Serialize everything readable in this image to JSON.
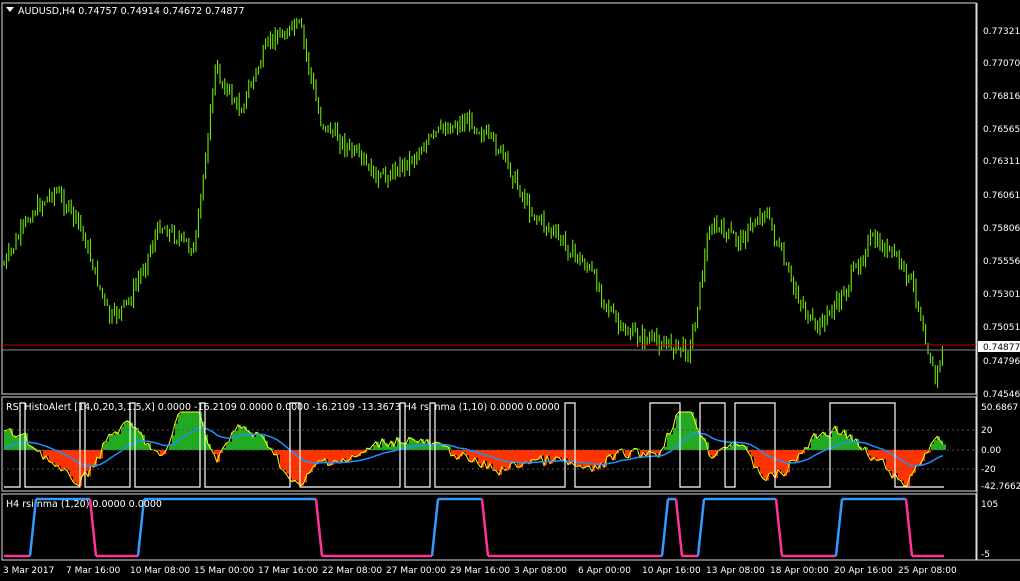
{
  "symbol_header": "AUDUSD,H4  0.74757 0.74914 0.74672 0.74877",
  "price_axis": [
    "0.77321",
    "0.77070",
    "0.76816",
    "0.76565",
    "0.76311",
    "0.76061",
    "0.75806",
    "0.75556",
    "0.75301",
    "0.75051",
    "0.74796",
    "0.74546"
  ],
  "current_price": "0.74877",
  "rsi_header": "RSI HistoAlert [14,0,20,3,1.5,X] 0.0000 -16.2109 0.0000 0.0000 -16.2109 -13.3673  H4 rsi nma (1,10) 0.0000 0.0000",
  "rsi_axis": [
    "50.6867",
    "20",
    "0.00",
    "-20",
    "-42.7662"
  ],
  "nma_header": "H4 rsi nma (1,20) 0.0000 0.0000",
  "nma_axis": [
    "105",
    "-5"
  ],
  "time_axis": [
    "3 Mar 2017",
    "7 Mar 16:00",
    "10 Mar 08:00",
    "15 Mar 00:00",
    "17 Mar 16:00",
    "22 Mar 08:00",
    "27 Mar 00:00",
    "29 Mar 16:00",
    "3 Apr 08:00",
    "6 Apr 00:00",
    "10 Apr 16:00",
    "13 Apr 08:00",
    "18 Apr 00:00",
    "20 Apr 16:00",
    "25 Apr 08:00"
  ],
  "colors": {
    "candle": "#7CFC00",
    "price_line": "#c00000",
    "rsi_line": "#ffff00",
    "signal_line": "#1e90ff",
    "hist_pos": "#22aa22",
    "hist_neg": "#ff3300",
    "nma_up": "#3399ff",
    "nma_down": "#ff3399"
  }
}
